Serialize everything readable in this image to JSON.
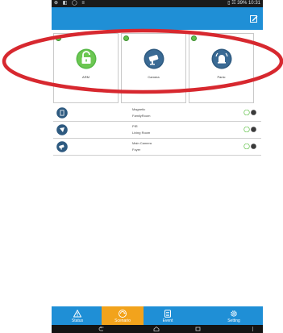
{
  "statusbar": {
    "left": "⊕ ◧ ◯ ≡",
    "right": "▯ ☵ 39% 10:31"
  },
  "tiles": [
    {
      "label": "ARM",
      "icon": "unlock-icon"
    },
    {
      "label": "Camera",
      "icon": "camera-icon"
    },
    {
      "label": "Panic",
      "icon": "panic-icon"
    }
  ],
  "devices": [
    {
      "name": "Magnetic",
      "location": "FamilyRoom",
      "icon": "door-sensor-icon"
    },
    {
      "name": "PIR",
      "location": "Living Room",
      "icon": "motion-sensor-icon"
    },
    {
      "name": "Main Camera",
      "location": "Foyer",
      "icon": "camera-icon"
    }
  ],
  "tabs": [
    {
      "label": "Status",
      "icon": "warning-icon"
    },
    {
      "label": "Scenario",
      "icon": "scenario-icon"
    },
    {
      "label": "Event",
      "icon": "event-icon"
    },
    {
      "label": "Setting",
      "icon": "gear-icon"
    }
  ],
  "colors": {
    "primary": "#1f8fd6",
    "active_tab": "#f2a31c",
    "online": "#62c24b",
    "highlight": "#d7282f"
  }
}
